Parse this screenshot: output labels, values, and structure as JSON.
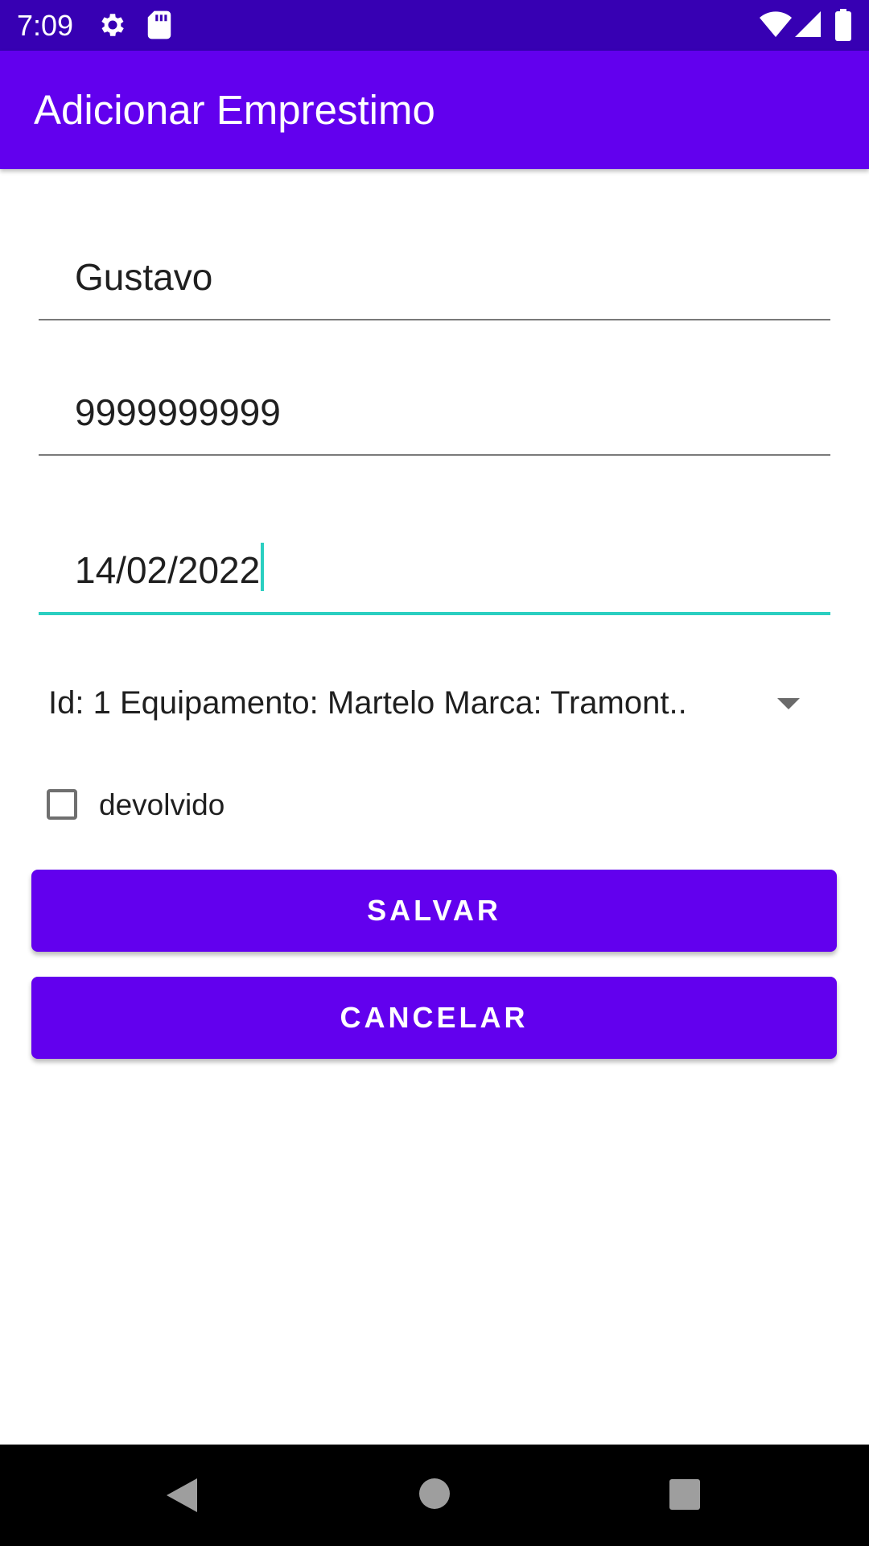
{
  "status_bar": {
    "time": "7:09",
    "icons": [
      "gear-icon",
      "sd-card-icon",
      "wifi-icon",
      "signal-icon",
      "battery-icon"
    ]
  },
  "app_bar": {
    "title": "Adicionar Emprestimo"
  },
  "form": {
    "name_value": "Gustavo",
    "phone_value": "9999999999",
    "date_value": "14/02/2022",
    "equipment_selected": "Id: 1 Equipamento: Martelo Marca: Tramont..",
    "returned_label": "devolvido",
    "returned_checked": false
  },
  "buttons": {
    "save_label": "SALVAR",
    "cancel_label": "CANCELAR"
  },
  "colors": {
    "primary": "#6200ee",
    "primary_dark": "#3700b3",
    "accent": "#2bcfc1"
  },
  "nav_bar": {
    "icons": [
      "back-icon",
      "home-icon",
      "recents-icon"
    ]
  }
}
